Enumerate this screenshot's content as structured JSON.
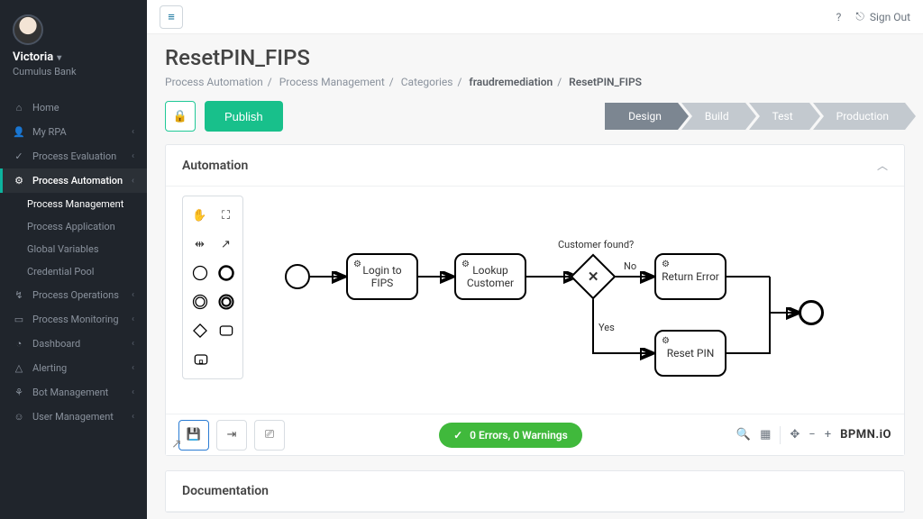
{
  "user": {
    "name": "Victoria",
    "org": "Cumulus Bank"
  },
  "topbar": {
    "help_icon": "?",
    "sign_out": "Sign Out"
  },
  "sidebar": {
    "items": [
      {
        "icon": "⌂",
        "label": "Home",
        "expandable": false
      },
      {
        "icon": "👤",
        "label": "My RPA",
        "expandable": true
      },
      {
        "icon": "✓",
        "label": "Process Evaluation",
        "expandable": true
      },
      {
        "icon": "⚙",
        "label": "Process Automation",
        "expandable": true,
        "active": true,
        "children": [
          {
            "label": "Process Management",
            "active": true
          },
          {
            "label": "Process Application"
          },
          {
            "label": "Global Variables"
          },
          {
            "label": "Credential Pool"
          }
        ]
      },
      {
        "icon": "↯",
        "label": "Process Operations",
        "expandable": true
      },
      {
        "icon": "▭",
        "label": "Process Monitoring",
        "expandable": true
      },
      {
        "icon": "◔",
        "label": "Dashboard",
        "expandable": true
      },
      {
        "icon": "△",
        "label": "Alerting",
        "expandable": true
      },
      {
        "icon": "⚘",
        "label": "Bot Management",
        "expandable": true
      },
      {
        "icon": "☺",
        "label": "User Management",
        "expandable": true
      }
    ]
  },
  "page": {
    "title": "ResetPIN_FIPS",
    "breadcrumbs": [
      "Process Automation",
      "Process Management",
      "Categories",
      "fraudremediation",
      "ResetPIN_FIPS"
    ]
  },
  "actions": {
    "publish": "Publish"
  },
  "pipeline": [
    "Design",
    "Build",
    "Test",
    "Production"
  ],
  "panel": {
    "title": "Automation"
  },
  "diagram": {
    "question": "Customer found?",
    "no": "No",
    "yes": "Yes",
    "tasks": {
      "login": "Login to FIPS",
      "lookup": "Lookup Customer",
      "return_error": "Return Error",
      "reset_pin": "Reset PIN"
    }
  },
  "status": "0 Errors, 0 Warnings",
  "brand": "BPMN.iO",
  "doc_panel": {
    "title": "Documentation"
  }
}
